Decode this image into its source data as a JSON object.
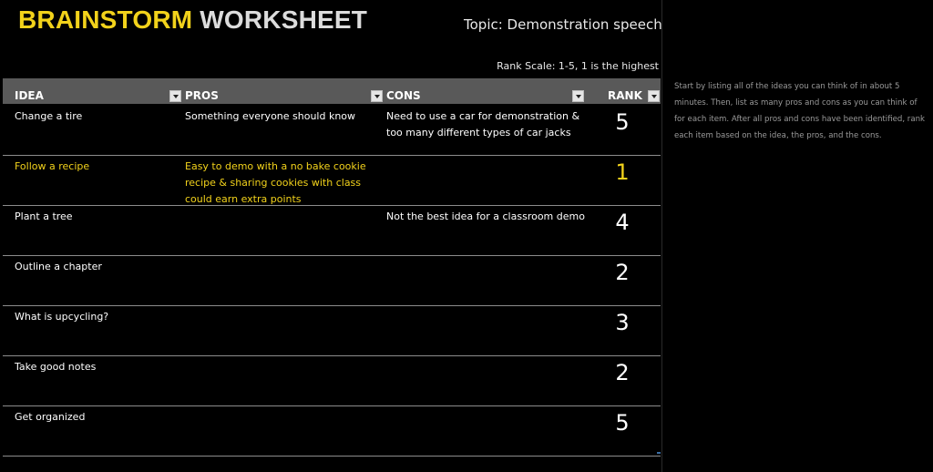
{
  "title": {
    "part1": "BRAINSTORM",
    "part2": "WORKSHEET"
  },
  "topic": "Topic: Demonstration speech",
  "rank_scale": "Rank Scale: 1-5, 1 is the highest",
  "instructions": "Start by listing all of the ideas you can think of in about 5 minutes. Then, list as many pros and cons as you can think of for each item. After all pros and cons have been identified, rank each item based on the idea, the pros, and the cons.",
  "columns": {
    "idea": "IDEA",
    "pros": "PROS",
    "cons": "CONS",
    "rank": "RANK"
  },
  "rows": [
    {
      "idea": "Change a tire",
      "pros": "Something everyone should know",
      "cons": "Need to use a car for demonstration & too many different types of car jacks",
      "rank": "5"
    },
    {
      "idea": "Follow a recipe",
      "pros": "Easy to demo with a no bake cookie recipe & sharing cookies with class could earn extra points",
      "cons": "",
      "rank": "1"
    },
    {
      "idea": "Plant a tree",
      "pros": "",
      "cons": "Not the best idea for a classroom demo",
      "rank": "4"
    },
    {
      "idea": "Outline a chapter",
      "pros": "",
      "cons": "",
      "rank": "2"
    },
    {
      "idea": "What is upcycling?",
      "pros": "",
      "cons": "",
      "rank": "3"
    },
    {
      "idea": "Take good notes",
      "pros": "",
      "cons": "",
      "rank": "2"
    },
    {
      "idea": "Get organized",
      "pros": "",
      "cons": "",
      "rank": "5"
    }
  ],
  "colors": {
    "accent": "#f2d21b",
    "header_bg": "#595959",
    "background": "#000000"
  }
}
